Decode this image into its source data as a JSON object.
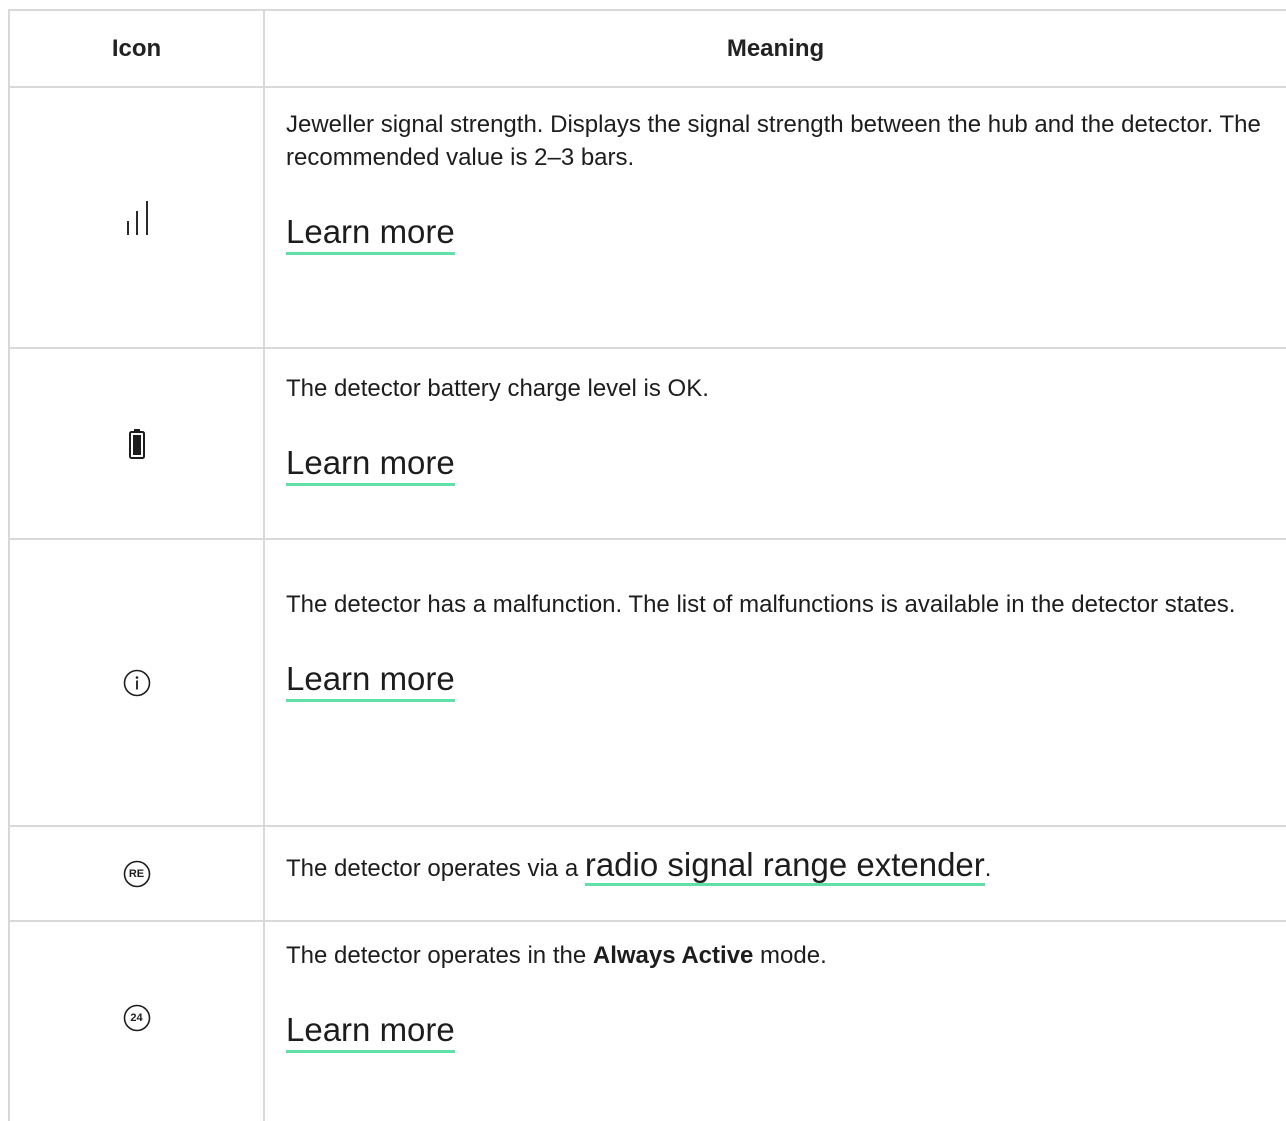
{
  "table": {
    "headers": {
      "icon": "Icon",
      "meaning": "Meaning"
    },
    "rows": [
      {
        "icon": "signal-strength-icon",
        "text": "Jeweller signal strength. Displays the signal strength between the hub and the detector. The recommended value is 2–3 bars.",
        "link": "Learn more"
      },
      {
        "icon": "battery-icon",
        "text": "The detector battery charge level is OK.",
        "link": "Learn more"
      },
      {
        "icon": "info-icon",
        "text": "The detector has a malfunction. The list of malfunctions is available in the detector states.",
        "link": "Learn more"
      },
      {
        "icon": "re-badge-icon",
        "icon_label": "RE",
        "text_before": "The detector operates via a ",
        "link": "radio signal range extender",
        "text_after": "."
      },
      {
        "icon": "24-badge-icon",
        "icon_label": "24",
        "text_before": "The detector operates in the ",
        "text_bold": "Always Active",
        "text_after": " mode.",
        "link": "Learn more"
      }
    ]
  },
  "colors": {
    "border": "#d9d9d9",
    "link_underline": "#5fe0a6",
    "text": "#1d1d1d"
  }
}
